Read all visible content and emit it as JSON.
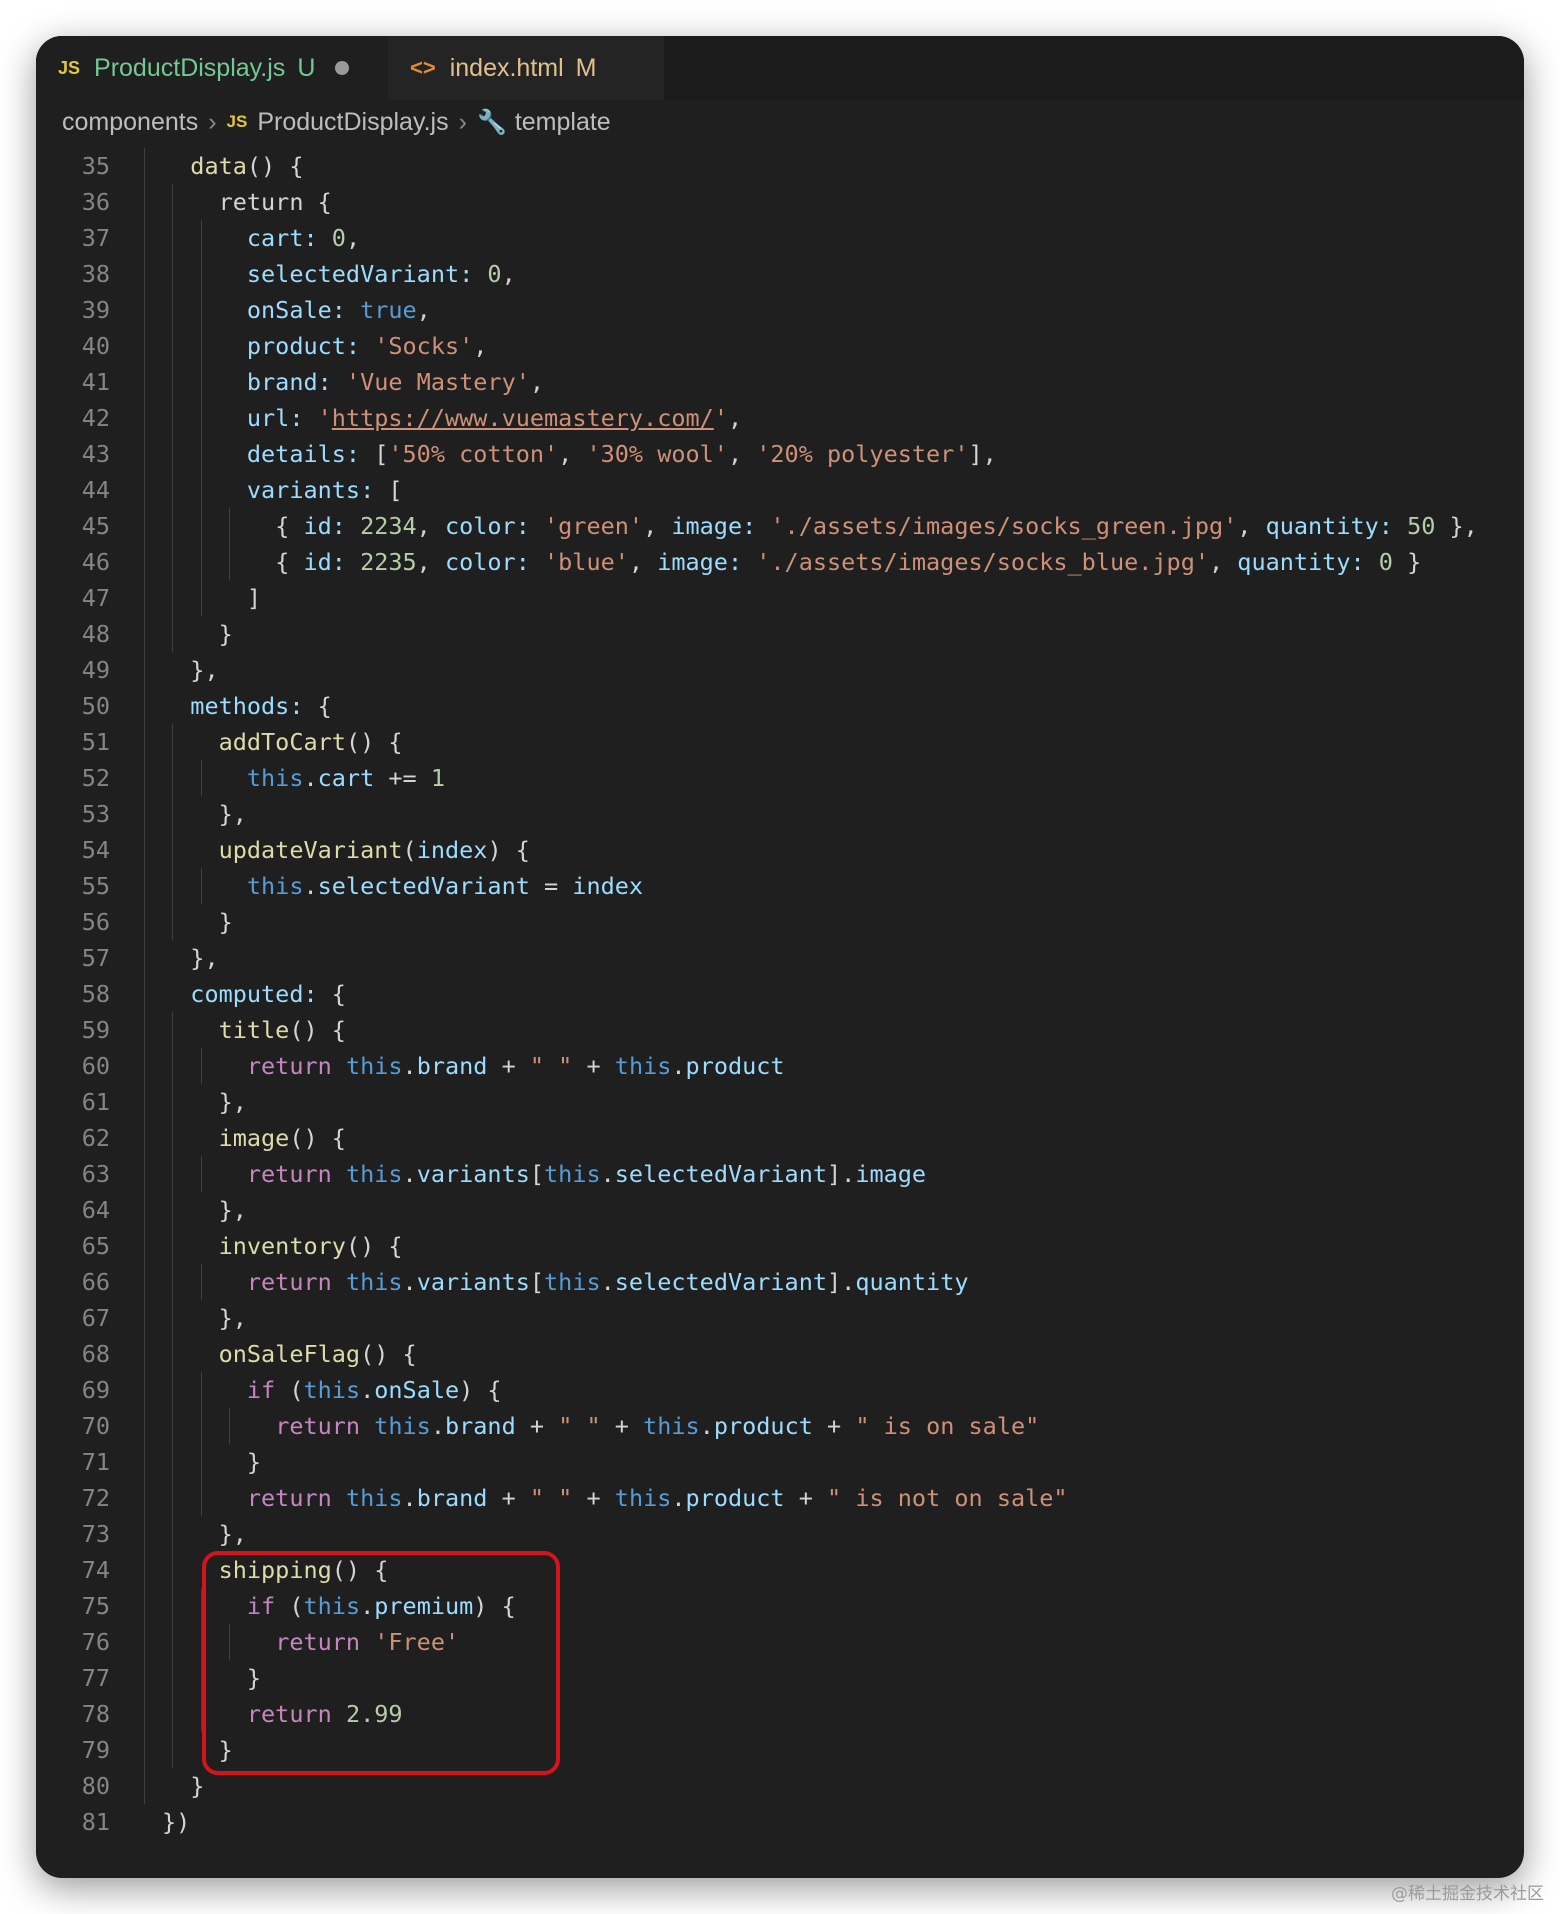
{
  "tabs": [
    {
      "icon": "JS",
      "label": "ProductDisplay.js",
      "status": "U"
    },
    {
      "icon": "<>",
      "label": "index.html",
      "status": "M"
    }
  ],
  "breadcrumb": {
    "folder": "components",
    "file_icon": "JS",
    "file": "ProductDisplay.js",
    "symbol": "template"
  },
  "code_lines": [
    {
      "num": 35,
      "indent": 1,
      "tokens": [
        [
          "f",
          "data"
        ],
        [
          "o",
          "() {"
        ]
      ]
    },
    {
      "num": 36,
      "indent": 2,
      "tokens": [
        [
          "o",
          "return {"
        ]
      ]
    },
    {
      "num": 37,
      "indent": 3,
      "tokens": [
        [
          "p",
          "cart: "
        ],
        [
          "n",
          "0"
        ],
        [
          "o",
          ","
        ]
      ]
    },
    {
      "num": 38,
      "indent": 3,
      "tokens": [
        [
          "p",
          "selectedVariant: "
        ],
        [
          "n",
          "0"
        ],
        [
          "o",
          ","
        ]
      ]
    },
    {
      "num": 39,
      "indent": 3,
      "tokens": [
        [
          "p",
          "onSale: "
        ],
        [
          "b",
          "true"
        ],
        [
          "o",
          ","
        ]
      ]
    },
    {
      "num": 40,
      "indent": 3,
      "tokens": [
        [
          "p",
          "product: "
        ],
        [
          "s",
          "'Socks'"
        ],
        [
          "o",
          ","
        ]
      ]
    },
    {
      "num": 41,
      "indent": 3,
      "tokens": [
        [
          "p",
          "brand: "
        ],
        [
          "s",
          "'Vue Mastery'"
        ],
        [
          "o",
          ","
        ]
      ]
    },
    {
      "num": 42,
      "indent": 3,
      "tokens": [
        [
          "p",
          "url: "
        ],
        [
          "s",
          "'"
        ],
        [
          "u",
          "https://www.vuemastery.com/"
        ],
        [
          "s",
          "'"
        ],
        [
          "o",
          ","
        ]
      ]
    },
    {
      "num": 43,
      "indent": 3,
      "tokens": [
        [
          "p",
          "details: "
        ],
        [
          "o",
          "["
        ],
        [
          "s",
          "'50% cotton'"
        ],
        [
          "o",
          ", "
        ],
        [
          "s",
          "'30% wool'"
        ],
        [
          "o",
          ", "
        ],
        [
          "s",
          "'20% polyester'"
        ],
        [
          "o",
          "],"
        ]
      ]
    },
    {
      "num": 44,
      "indent": 3,
      "tokens": [
        [
          "p",
          "variants: "
        ],
        [
          "o",
          "["
        ]
      ]
    },
    {
      "num": 45,
      "indent": 4,
      "tokens": [
        [
          "o",
          "{ "
        ],
        [
          "p",
          "id: "
        ],
        [
          "n",
          "2234"
        ],
        [
          "o",
          ", "
        ],
        [
          "p",
          "color: "
        ],
        [
          "s",
          "'green'"
        ],
        [
          "o",
          ", "
        ],
        [
          "p",
          "image: "
        ],
        [
          "s",
          "'./assets/images/socks_green.jpg'"
        ],
        [
          "o",
          ", "
        ],
        [
          "p",
          "quantity: "
        ],
        [
          "n",
          "50"
        ],
        [
          "o",
          " },"
        ]
      ]
    },
    {
      "num": 46,
      "indent": 4,
      "tokens": [
        [
          "o",
          "{ "
        ],
        [
          "p",
          "id: "
        ],
        [
          "n",
          "2235"
        ],
        [
          "o",
          ", "
        ],
        [
          "p",
          "color: "
        ],
        [
          "s",
          "'blue'"
        ],
        [
          "o",
          ", "
        ],
        [
          "p",
          "image: "
        ],
        [
          "s",
          "'./assets/images/socks_blue.jpg'"
        ],
        [
          "o",
          ", "
        ],
        [
          "p",
          "quantity: "
        ],
        [
          "n",
          "0"
        ],
        [
          "o",
          " }"
        ]
      ]
    },
    {
      "num": 47,
      "indent": 3,
      "tokens": [
        [
          "o",
          "]"
        ]
      ]
    },
    {
      "num": 48,
      "indent": 2,
      "tokens": [
        [
          "o",
          "}"
        ]
      ]
    },
    {
      "num": 49,
      "indent": 1,
      "tokens": [
        [
          "o",
          "},"
        ]
      ]
    },
    {
      "num": 50,
      "indent": 1,
      "tokens": [
        [
          "p",
          "methods: "
        ],
        [
          "o",
          "{"
        ]
      ]
    },
    {
      "num": 51,
      "indent": 2,
      "tokens": [
        [
          "f",
          "addToCart"
        ],
        [
          "o",
          "() {"
        ]
      ]
    },
    {
      "num": 52,
      "indent": 3,
      "tokens": [
        [
          "b",
          "this"
        ],
        [
          "o",
          "."
        ],
        [
          "p",
          "cart"
        ],
        [
          "o",
          " += "
        ],
        [
          "n",
          "1"
        ]
      ]
    },
    {
      "num": 53,
      "indent": 2,
      "tokens": [
        [
          "o",
          "},"
        ]
      ]
    },
    {
      "num": 54,
      "indent": 2,
      "tokens": [
        [
          "f",
          "updateVariant"
        ],
        [
          "o",
          "("
        ],
        [
          "p",
          "index"
        ],
        [
          "o",
          ") {"
        ]
      ]
    },
    {
      "num": 55,
      "indent": 3,
      "tokens": [
        [
          "b",
          "this"
        ],
        [
          "o",
          "."
        ],
        [
          "p",
          "selectedVariant"
        ],
        [
          "o",
          " = "
        ],
        [
          "p",
          "index"
        ]
      ]
    },
    {
      "num": 56,
      "indent": 2,
      "tokens": [
        [
          "o",
          "}"
        ]
      ]
    },
    {
      "num": 57,
      "indent": 1,
      "tokens": [
        [
          "o",
          "},"
        ]
      ]
    },
    {
      "num": 58,
      "indent": 1,
      "tokens": [
        [
          "p",
          "computed: "
        ],
        [
          "o",
          "{"
        ]
      ]
    },
    {
      "num": 59,
      "indent": 2,
      "tokens": [
        [
          "f",
          "title"
        ],
        [
          "o",
          "() {"
        ]
      ]
    },
    {
      "num": 60,
      "indent": 3,
      "tokens": [
        [
          "k",
          "return "
        ],
        [
          "b",
          "this"
        ],
        [
          "o",
          "."
        ],
        [
          "p",
          "brand"
        ],
        [
          "o",
          " + "
        ],
        [
          "s",
          "\" \""
        ],
        [
          "o",
          " + "
        ],
        [
          "b",
          "this"
        ],
        [
          "o",
          "."
        ],
        [
          "p",
          "product"
        ]
      ]
    },
    {
      "num": 61,
      "indent": 2,
      "tokens": [
        [
          "o",
          "},"
        ]
      ]
    },
    {
      "num": 62,
      "indent": 2,
      "tokens": [
        [
          "f",
          "image"
        ],
        [
          "o",
          "() {"
        ]
      ]
    },
    {
      "num": 63,
      "indent": 3,
      "tokens": [
        [
          "k",
          "return "
        ],
        [
          "b",
          "this"
        ],
        [
          "o",
          "."
        ],
        [
          "p",
          "variants"
        ],
        [
          "o",
          "["
        ],
        [
          "b",
          "this"
        ],
        [
          "o",
          "."
        ],
        [
          "p",
          "selectedVariant"
        ],
        [
          "o",
          "]."
        ],
        [
          "p",
          "image"
        ]
      ]
    },
    {
      "num": 64,
      "indent": 2,
      "tokens": [
        [
          "o",
          "},"
        ]
      ]
    },
    {
      "num": 65,
      "indent": 2,
      "tokens": [
        [
          "f",
          "inventory"
        ],
        [
          "o",
          "() {"
        ]
      ]
    },
    {
      "num": 66,
      "indent": 3,
      "tokens": [
        [
          "k",
          "return "
        ],
        [
          "b",
          "this"
        ],
        [
          "o",
          "."
        ],
        [
          "p",
          "variants"
        ],
        [
          "o",
          "["
        ],
        [
          "b",
          "this"
        ],
        [
          "o",
          "."
        ],
        [
          "p",
          "selectedVariant"
        ],
        [
          "o",
          "]."
        ],
        [
          "p",
          "quantity"
        ]
      ]
    },
    {
      "num": 67,
      "indent": 2,
      "tokens": [
        [
          "o",
          "},"
        ]
      ]
    },
    {
      "num": 68,
      "indent": 2,
      "tokens": [
        [
          "f",
          "onSaleFlag"
        ],
        [
          "o",
          "() {"
        ]
      ]
    },
    {
      "num": 69,
      "indent": 3,
      "tokens": [
        [
          "k",
          "if "
        ],
        [
          "o",
          "("
        ],
        [
          "b",
          "this"
        ],
        [
          "o",
          "."
        ],
        [
          "p",
          "onSale"
        ],
        [
          "o",
          ") {"
        ]
      ]
    },
    {
      "num": 70,
      "indent": 4,
      "tokens": [
        [
          "k",
          "return "
        ],
        [
          "b",
          "this"
        ],
        [
          "o",
          "."
        ],
        [
          "p",
          "brand"
        ],
        [
          "o",
          " + "
        ],
        [
          "s",
          "\" \""
        ],
        [
          "o",
          " + "
        ],
        [
          "b",
          "this"
        ],
        [
          "o",
          "."
        ],
        [
          "p",
          "product"
        ],
        [
          "o",
          " + "
        ],
        [
          "s",
          "\" is on sale\""
        ]
      ]
    },
    {
      "num": 71,
      "indent": 3,
      "tokens": [
        [
          "o",
          "}"
        ]
      ]
    },
    {
      "num": 72,
      "indent": 3,
      "tokens": [
        [
          "k",
          "return "
        ],
        [
          "b",
          "this"
        ],
        [
          "o",
          "."
        ],
        [
          "p",
          "brand"
        ],
        [
          "o",
          " + "
        ],
        [
          "s",
          "\" \""
        ],
        [
          "o",
          " + "
        ],
        [
          "b",
          "this"
        ],
        [
          "o",
          "."
        ],
        [
          "p",
          "product"
        ],
        [
          "o",
          " + "
        ],
        [
          "s",
          "\" is not on sale\""
        ]
      ]
    },
    {
      "num": 73,
      "indent": 2,
      "tokens": [
        [
          "o",
          "},"
        ]
      ]
    },
    {
      "num": 74,
      "indent": 2,
      "tokens": [
        [
          "f",
          "shipping"
        ],
        [
          "o",
          "() {"
        ]
      ]
    },
    {
      "num": 75,
      "indent": 3,
      "tokens": [
        [
          "k",
          "if "
        ],
        [
          "o",
          "("
        ],
        [
          "b",
          "this"
        ],
        [
          "o",
          "."
        ],
        [
          "p",
          "premium"
        ],
        [
          "o",
          ") {"
        ]
      ]
    },
    {
      "num": 76,
      "indent": 4,
      "tokens": [
        [
          "k",
          "return "
        ],
        [
          "s",
          "'Free'"
        ]
      ]
    },
    {
      "num": 77,
      "indent": 3,
      "tokens": [
        [
          "o",
          "}"
        ]
      ]
    },
    {
      "num": 78,
      "indent": 3,
      "tokens": [
        [
          "k",
          "return "
        ],
        [
          "n",
          "2.99"
        ]
      ]
    },
    {
      "num": 79,
      "indent": 2,
      "tokens": [
        [
          "o",
          "}"
        ]
      ]
    },
    {
      "num": 80,
      "indent": 1,
      "tokens": [
        [
          "o",
          "}"
        ]
      ]
    },
    {
      "num": 81,
      "indent": 0,
      "tokens": [
        [
          "o",
          "})"
        ]
      ]
    }
  ],
  "highlight_color": "#d4141c",
  "watermark": "@稀土掘金技术社区"
}
